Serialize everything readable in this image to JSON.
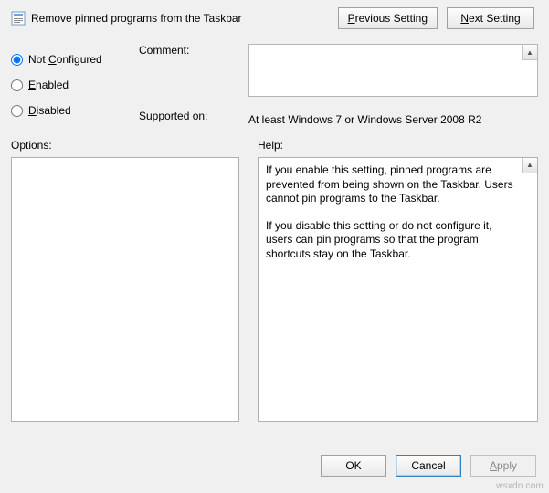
{
  "header": {
    "title": "Remove pinned programs from the Taskbar",
    "prev_label_pre": "",
    "prev_underline": "P",
    "prev_label_post": "revious Setting",
    "next_label_pre": "",
    "next_underline": "N",
    "next_label_post": "ext Setting"
  },
  "state": {
    "not_configured_pre": "Not ",
    "not_configured_underline": "C",
    "not_configured_post": "onfigured",
    "enabled_underline": "E",
    "enabled_post": "nabled",
    "disabled_underline": "D",
    "disabled_post": "isabled",
    "selected": "not_configured"
  },
  "labels": {
    "comment": "Comment:",
    "supported": "Supported on:",
    "options": "Options:",
    "help": "Help:"
  },
  "supported_value": "At least Windows 7 or Windows Server 2008 R2",
  "help_text": {
    "p1": "If you enable this setting, pinned programs are prevented from being shown on the Taskbar. Users cannot pin programs to the Taskbar.",
    "p2": "If you disable this setting or do not configure it, users can pin programs so that the program shortcuts stay on the Taskbar."
  },
  "footer": {
    "ok": "OK",
    "cancel": "Cancel",
    "apply_underline": "A",
    "apply_post": "pply"
  },
  "watermark": "wsxdn.com"
}
